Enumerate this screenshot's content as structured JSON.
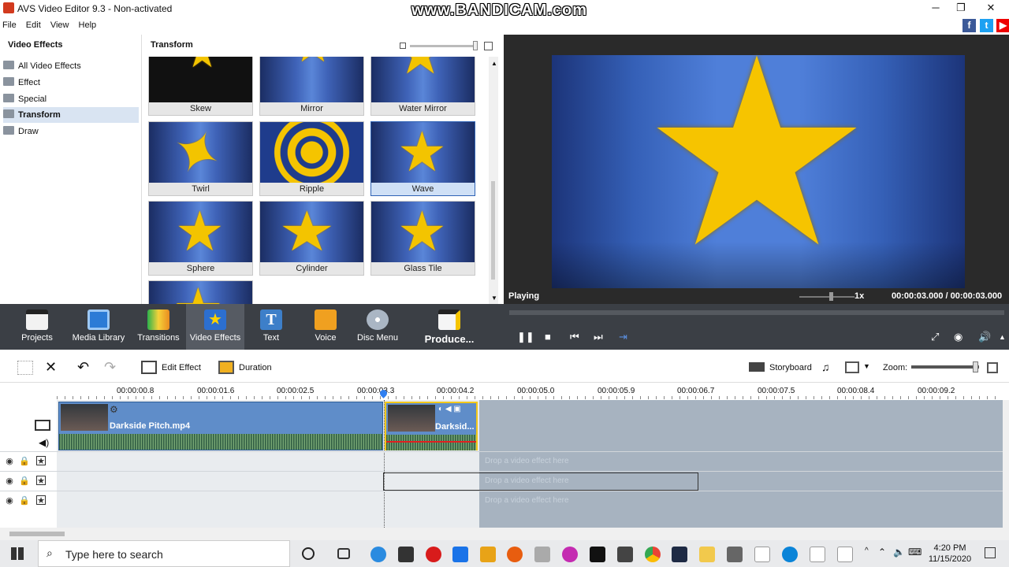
{
  "window": {
    "title": "AVS Video Editor 9.3 - Non-activated",
    "watermark": "www.BANDICAM.com",
    "controls": [
      "─",
      "❐",
      "✕"
    ]
  },
  "menu": [
    "File",
    "Edit",
    "View",
    "Help"
  ],
  "left_panel": {
    "header": "Video Effects",
    "items": [
      {
        "label": "All Video Effects",
        "active": false
      },
      {
        "label": "Effect",
        "active": false
      },
      {
        "label": "Special",
        "active": false
      },
      {
        "label": "Transform",
        "active": true
      },
      {
        "label": "Draw",
        "active": false
      }
    ]
  },
  "grid_panel": {
    "header": "Transform",
    "tiles": [
      {
        "label": "Skew"
      },
      {
        "label": "Mirror"
      },
      {
        "label": "Water Mirror"
      },
      {
        "label": "Twirl"
      },
      {
        "label": "Ripple"
      },
      {
        "label": "Wave",
        "selected": true
      },
      {
        "label": "Sphere"
      },
      {
        "label": "Cylinder"
      },
      {
        "label": "Glass Tile"
      },
      {
        "label": ""
      }
    ]
  },
  "preview": {
    "status": "Playing",
    "speed": "1x",
    "time_current": "00:00:03.000",
    "time_sep": "/",
    "time_total": "00:00:03.000"
  },
  "toolbar": {
    "items": [
      {
        "label": "Projects",
        "icon": "projects-icon"
      },
      {
        "label": "Media Library",
        "icon": "media-library-icon"
      },
      {
        "label": "Transitions",
        "icon": "transitions-icon"
      },
      {
        "label": "Video Effects",
        "icon": "video-effects-icon",
        "active": true
      },
      {
        "label": "Text",
        "icon": "text-icon"
      },
      {
        "label": "Voice",
        "icon": "voice-icon"
      },
      {
        "label": "Disc Menu",
        "icon": "disc-menu-icon"
      },
      {
        "label": "Produce...",
        "icon": "produce-icon"
      }
    ]
  },
  "timeline_tools": {
    "edit_effect": "Edit Effect",
    "duration": "Duration",
    "storyboard": "Storyboard",
    "zoom": "Zoom:"
  },
  "ruler": [
    "00:00:00.8",
    "00:00:01.6",
    "00:00:02.5",
    "00:00:03.3",
    "00:00:04.2",
    "00:00:05.0",
    "00:00:05.9",
    "00:00:06.7",
    "00:00:07.5",
    "00:00:08.4",
    "00:00:09.2"
  ],
  "clips": [
    {
      "name": "Darkside Pitch.mp4"
    },
    {
      "name": "Darksid..."
    }
  ],
  "fx_rows": {
    "drop_text": "Drop a video effect here"
  },
  "taskbar": {
    "search_placeholder": "Type here to search",
    "time": "4:20 PM",
    "date": "11/15/2020"
  },
  "colors": {
    "accent": "#2f63b5",
    "toolbar_bg": "#3b3f45",
    "preview_blue": "#4f7fd9",
    "star": "#f6c400"
  }
}
